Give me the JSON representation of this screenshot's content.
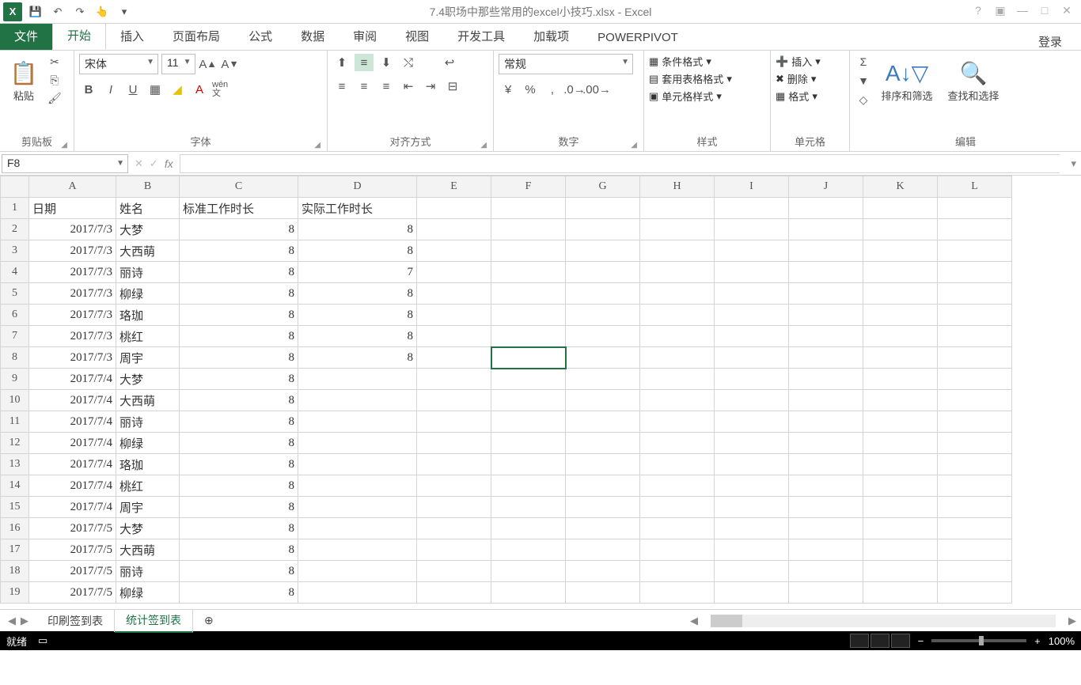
{
  "title": "7.4职场中那些常用的excel小技巧.xlsx - Excel",
  "qat": {
    "save": "💾",
    "undo": "↶",
    "redo": "↷",
    "touch": "👆"
  },
  "tabs": {
    "file": "文件",
    "home": "开始",
    "insert": "插入",
    "layout": "页面布局",
    "formula": "公式",
    "data": "数据",
    "review": "审阅",
    "view": "视图",
    "developer": "开发工具",
    "addin": "加载项",
    "powerpivot": "POWERPIVOT",
    "login": "登录"
  },
  "ribbon": {
    "clipboard": {
      "paste": "粘贴",
      "label": "剪贴板"
    },
    "font": {
      "name": "宋体",
      "size": "11",
      "label": "字体",
      "wen": "wén\n文"
    },
    "align": {
      "label": "对齐方式"
    },
    "number": {
      "format": "常规",
      "label": "数字"
    },
    "styles": {
      "cond": "条件格式",
      "table": "套用表格格式",
      "cell": "单元格样式",
      "label": "样式"
    },
    "cells": {
      "insert": "插入",
      "delete": "删除",
      "format": "格式",
      "label": "单元格"
    },
    "editing": {
      "sort": "排序和筛选",
      "find": "查找和选择",
      "label": "编辑"
    }
  },
  "namebox": "F8",
  "columns": [
    "A",
    "B",
    "C",
    "D",
    "E",
    "F",
    "G",
    "H",
    "I",
    "J",
    "K",
    "L"
  ],
  "headers": {
    "A": "日期",
    "B": "姓名",
    "C": "标准工作时长",
    "D": "实际工作时长"
  },
  "rows": [
    {
      "n": 1,
      "A": "日期",
      "B": "姓名",
      "C": "标准工作时长",
      "D": "实际工作时长",
      "hdr": true
    },
    {
      "n": 2,
      "A": "2017/7/3",
      "B": "大梦",
      "C": "8",
      "D": "8"
    },
    {
      "n": 3,
      "A": "2017/7/3",
      "B": "大西萌",
      "C": "8",
      "D": "8"
    },
    {
      "n": 4,
      "A": "2017/7/3",
      "B": "丽诗",
      "C": "8",
      "D": "7"
    },
    {
      "n": 5,
      "A": "2017/7/3",
      "B": "柳绿",
      "C": "8",
      "D": "8"
    },
    {
      "n": 6,
      "A": "2017/7/3",
      "B": "珞珈",
      "C": "8",
      "D": "8"
    },
    {
      "n": 7,
      "A": "2017/7/3",
      "B": "桃红",
      "C": "8",
      "D": "8"
    },
    {
      "n": 8,
      "A": "2017/7/3",
      "B": "周宇",
      "C": "8",
      "D": "8"
    },
    {
      "n": 9,
      "A": "2017/7/4",
      "B": "大梦",
      "C": "8",
      "D": ""
    },
    {
      "n": 10,
      "A": "2017/7/4",
      "B": "大西萌",
      "C": "8",
      "D": ""
    },
    {
      "n": 11,
      "A": "2017/7/4",
      "B": "丽诗",
      "C": "8",
      "D": ""
    },
    {
      "n": 12,
      "A": "2017/7/4",
      "B": "柳绿",
      "C": "8",
      "D": ""
    },
    {
      "n": 13,
      "A": "2017/7/4",
      "B": "珞珈",
      "C": "8",
      "D": ""
    },
    {
      "n": 14,
      "A": "2017/7/4",
      "B": "桃红",
      "C": "8",
      "D": ""
    },
    {
      "n": 15,
      "A": "2017/7/4",
      "B": "周宇",
      "C": "8",
      "D": ""
    },
    {
      "n": 16,
      "A": "2017/7/5",
      "B": "大梦",
      "C": "8",
      "D": ""
    },
    {
      "n": 17,
      "A": "2017/7/5",
      "B": "大西萌",
      "C": "8",
      "D": ""
    },
    {
      "n": 18,
      "A": "2017/7/5",
      "B": "丽诗",
      "C": "8",
      "D": ""
    },
    {
      "n": 19,
      "A": "2017/7/5",
      "B": "柳绿",
      "C": "8",
      "D": ""
    }
  ],
  "colwidths": {
    "A": 110,
    "B": 80,
    "C": 150,
    "D": 150,
    "E": 94,
    "F": 94,
    "G": 94,
    "H": 94,
    "I": 94,
    "J": 94,
    "K": 94,
    "L": 94
  },
  "sheets": {
    "s1": "印刷签到表",
    "s2": "统计签到表"
  },
  "status": {
    "ready": "就绪",
    "zoom": "100%"
  },
  "activeCell": "F8"
}
